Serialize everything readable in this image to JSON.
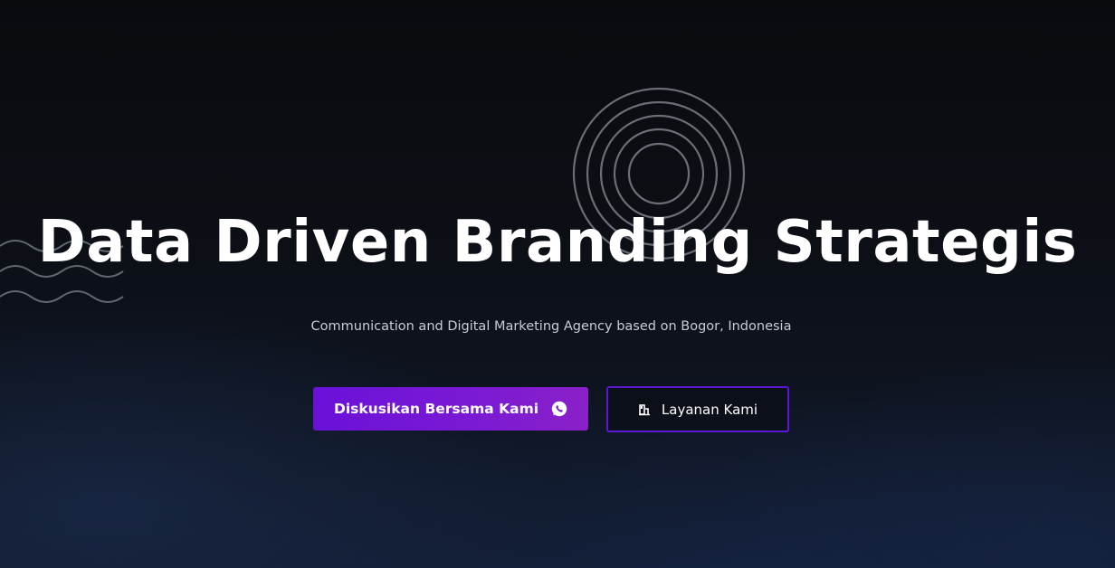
{
  "hero": {
    "title": "Data Driven Branding Strategis",
    "subtitle": "Communication and Digital Marketing Agency based on Bogor, Indonesia",
    "primary_button": {
      "label": "Diskusikan Bersama Kami",
      "icon": "whatsapp-icon"
    },
    "secondary_button": {
      "label": "Layanan Kami",
      "icon": "service-icon"
    }
  },
  "colors": {
    "background": "#0b0d12",
    "accent_purple": "#6a11d8",
    "accent_border": "#5a17d4",
    "text_primary": "#ffffff",
    "text_secondary": "#c9ccd4"
  },
  "decorations": {
    "concentric_circles": "concentric-circles-decoration",
    "wave_lines": "wave-lines-decoration"
  }
}
